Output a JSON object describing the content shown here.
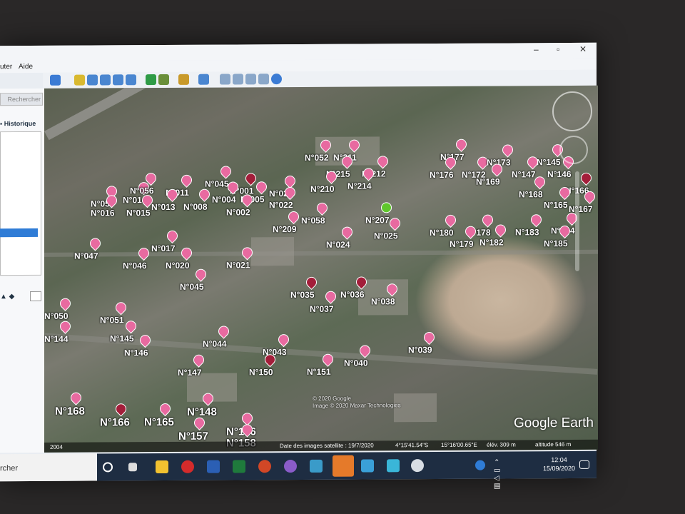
{
  "menu": {
    "outils": "uter",
    "aide": "Aide"
  },
  "sidebar": {
    "search_button": "Rechercher",
    "tab_historique": "Historique"
  },
  "map": {
    "brand": "Google Earth",
    "copyright_line1": "© 2020 Google",
    "copyright_line2": "Image © 2020 Maxar Technologies",
    "status": {
      "imagery_date": "Date des images satellite : 19/7/2020",
      "lat": "4°15'41.54\"S",
      "lon": "15°16'00.65\"E",
      "elev": "élév. 309 m",
      "altitude": "altitude 546 m",
      "year": "2004"
    },
    "markers": [
      {
        "label": "N°052",
        "color": "pink"
      },
      {
        "label": "N°211",
        "color": "pink"
      },
      {
        "label": "N°215",
        "color": "pink"
      },
      {
        "label": "N°212",
        "color": "pink"
      },
      {
        "label": "N°214",
        "color": "pink"
      },
      {
        "label": "N°210",
        "color": "pink"
      },
      {
        "label": "N°177",
        "color": "pink"
      },
      {
        "label": "N°176",
        "color": "pink"
      },
      {
        "label": "N°172",
        "color": "pink"
      },
      {
        "label": "N°173",
        "color": "pink"
      },
      {
        "label": "N°169",
        "color": "pink"
      },
      {
        "label": "N°145",
        "color": "pink"
      },
      {
        "label": "N°147",
        "color": "pink"
      },
      {
        "label": "N°146",
        "color": "pink"
      },
      {
        "label": "N°166",
        "color": "dark"
      },
      {
        "label": "N°168",
        "color": "pink"
      },
      {
        "label": "N°165",
        "color": "pink"
      },
      {
        "label": "N°167",
        "color": "pink"
      },
      {
        "label": "N°057",
        "color": "pink"
      },
      {
        "label": "N°014",
        "color": "pink"
      },
      {
        "label": "N°056",
        "color": "pink"
      },
      {
        "label": "N°011",
        "color": "pink"
      },
      {
        "label": "N°045",
        "color": "pink"
      },
      {
        "label": "N°001",
        "color": "dark"
      },
      {
        "label": "N°023",
        "color": "pink"
      },
      {
        "label": "N°016",
        "color": "pink"
      },
      {
        "label": "N°015",
        "color": "pink"
      },
      {
        "label": "N°013",
        "color": "pink"
      },
      {
        "label": "N°008",
        "color": "pink"
      },
      {
        "label": "N°004",
        "color": "pink"
      },
      {
        "label": "N°005",
        "color": "pink"
      },
      {
        "label": "N°002",
        "color": "pink"
      },
      {
        "label": "N°022",
        "color": "pink"
      },
      {
        "label": "N°209",
        "color": "pink"
      },
      {
        "label": "N°058",
        "color": "pink"
      },
      {
        "label": "N°207",
        "color": "green"
      },
      {
        "label": "N°025",
        "color": "pink"
      },
      {
        "label": "N°180",
        "color": "pink"
      },
      {
        "label": "N°178",
        "color": "pink"
      },
      {
        "label": "N°183",
        "color": "pink"
      },
      {
        "label": "N°184",
        "color": "pink"
      },
      {
        "label": "N°179",
        "color": "pink"
      },
      {
        "label": "N°182",
        "color": "pink"
      },
      {
        "label": "N°185",
        "color": "pink"
      },
      {
        "label": "N°047",
        "color": "pink"
      },
      {
        "label": "N°017",
        "color": "pink"
      },
      {
        "label": "N°024",
        "color": "pink"
      },
      {
        "label": "N°046",
        "color": "pink"
      },
      {
        "label": "N°020",
        "color": "pink"
      },
      {
        "label": "N°021",
        "color": "pink"
      },
      {
        "label": "N°045",
        "color": "pink"
      },
      {
        "label": "N°035",
        "color": "dark"
      },
      {
        "label": "N°036",
        "color": "dark"
      },
      {
        "label": "N°037",
        "color": "pink"
      },
      {
        "label": "N°038",
        "color": "pink"
      },
      {
        "label": "N°050",
        "color": "pink"
      },
      {
        "label": "N°051",
        "color": "pink"
      },
      {
        "label": "N°144",
        "color": "pink"
      },
      {
        "label": "N°145",
        "color": "pink"
      },
      {
        "label": "N°146",
        "color": "pink"
      },
      {
        "label": "N°044",
        "color": "pink"
      },
      {
        "label": "N°043",
        "color": "pink"
      },
      {
        "label": "N°039",
        "color": "pink"
      },
      {
        "label": "N°147",
        "color": "pink"
      },
      {
        "label": "N°150",
        "color": "dark"
      },
      {
        "label": "N°151",
        "color": "pink"
      },
      {
        "label": "N°040",
        "color": "pink"
      },
      {
        "label": "N°168",
        "color": "pink"
      },
      {
        "label": "N°166",
        "color": "dark"
      },
      {
        "label": "N°165",
        "color": "pink"
      },
      {
        "label": "N°148",
        "color": "pink"
      },
      {
        "label": "N°157",
        "color": "pink"
      },
      {
        "label": "N°156",
        "color": "pink"
      },
      {
        "label": "N°158",
        "color": "pink"
      }
    ]
  },
  "taskbar": {
    "search": "rcher",
    "time": "12:04",
    "date": "15/09/2020"
  },
  "colors": {
    "pin": "#e86aa0",
    "pin_dark": "#a31e3a",
    "pin_green": "#5fc72c"
  }
}
